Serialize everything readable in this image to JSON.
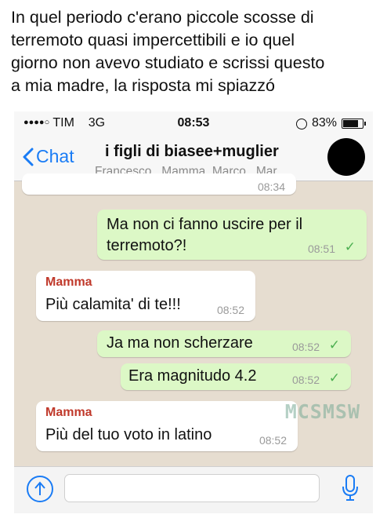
{
  "caption": {
    "line1": "In quel periodo c'erano piccole scosse di",
    "line2": "terremoto quasi impercettibili e io quel",
    "line3": "giorno non avevo studiato e scrissi questo",
    "line4": "a mia madre, la risposta mi spiazzó"
  },
  "status": {
    "carrier": "TIM",
    "network": "3G",
    "time": "08:53",
    "battery": "83%",
    "battery_level": 0.83
  },
  "nav": {
    "back_label": "Chat",
    "title": "i figli di biasee+muglier",
    "members": "Francesco , Mamma, Marco , Mar..."
  },
  "messages": [
    {
      "time": "08:34"
    },
    {
      "text_line1": "Ma non ci fanno uscire per il",
      "text_line2": "terremoto?!",
      "time": "08:51",
      "status": "✓"
    },
    {
      "sender": "Mamma",
      "text": "Più calamita' di te!!!",
      "time": "08:52"
    },
    {
      "text": "Ja ma non scherzare",
      "time": "08:52",
      "status": "✓"
    },
    {
      "text": "Era magnitudo 4.2",
      "time": "08:52",
      "status": "✓"
    },
    {
      "sender": "Mamma",
      "text": "Più del tuo voto in latino",
      "time": "08:52"
    }
  ],
  "watermark": "MCSMSW",
  "input": {
    "value": ""
  },
  "colors": {
    "accent": "#1a7cf5",
    "outgoing": "#dcf8c6",
    "sender": "#c0392b",
    "check": "#4caf50"
  },
  "icons": [
    "back-chevron-icon",
    "lock-rotation-icon",
    "battery-icon",
    "share-arrow-icon",
    "microphone-icon",
    "check-icon"
  ]
}
